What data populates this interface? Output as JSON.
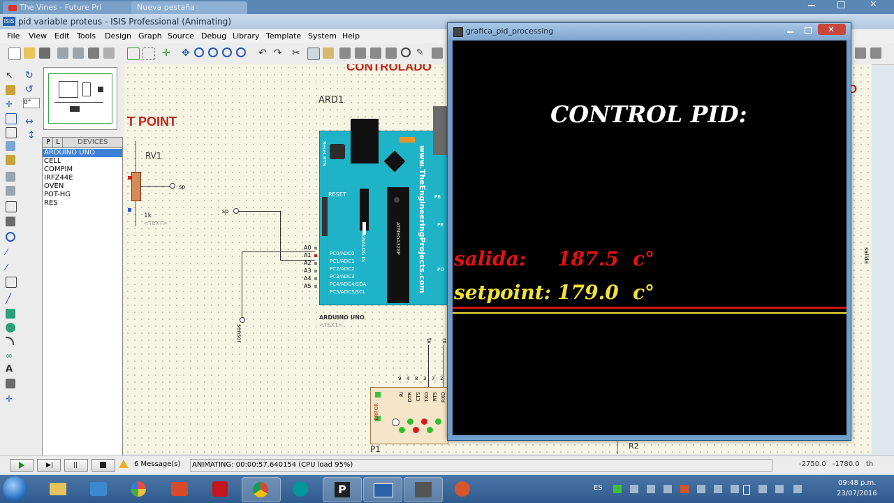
{
  "browser_tabs": [
    {
      "title": "The Vines - Future Pri"
    },
    {
      "title": "Nueva pestaña"
    }
  ],
  "window": {
    "title": "pid variable proteus - ISIS Professional (Animating)",
    "icon_label": "ISIS"
  },
  "menu": [
    "File",
    "View",
    "Edit",
    "Tools",
    "Design",
    "Graph",
    "Source",
    "Debug",
    "Library",
    "Template",
    "System",
    "Help"
  ],
  "rotation": {
    "value": "0°"
  },
  "device_panel": {
    "tab_p": "P",
    "tab_l": "L",
    "header": "DEVICES",
    "items": [
      "ARDUINO UNO",
      "CELL",
      "COMPIM",
      "IRFZ44E",
      "OVEN",
      "POT-HG",
      "RES"
    ],
    "selected_index": 0
  },
  "schematic": {
    "title_partial": "CONTROLADO",
    "setpoint_label": "T POINT",
    "pot_ref": "RV1",
    "pot_value": "1k",
    "text_placeholder": "<TEXT>",
    "sp_label": "sp",
    "sensor_label": "sensor",
    "salida_label": "salida",
    "arduino_ref": "ARD1",
    "arduino_name": "ARDUINO UNO",
    "website": "www.TheEngineeringProjects.com",
    "reset_btn": "Reset BTN",
    "reset_pin": "RESET",
    "analog_in": "ANALOG IN",
    "pins_analog": [
      "A0",
      "A1",
      "A2",
      "A3",
      "A4",
      "A5"
    ],
    "ports": [
      "PC0/ADC0",
      "PC1/ADC1",
      "PC2/ADC2",
      "PC3/ADC3",
      "PC4/ADC4/SDA",
      "PC5/ADC5/SCL"
    ],
    "chip_label": "ATMEGA328P",
    "right_labels": [
      "PB",
      "PB",
      "PD"
    ],
    "compim": {
      "ref": "P1",
      "error": "ERROR",
      "pins": [
        "RI",
        "DTR",
        "CTS",
        "TXD",
        "RTS",
        "RXD"
      ],
      "numbers": [
        "9",
        "4",
        "8",
        "3",
        "7",
        "2"
      ]
    },
    "r2": "R2",
    "tx_label": "tx",
    "rx_label": "rx",
    "right_partial": "O"
  },
  "status": {
    "messages": "6 Message(s)",
    "animating": "ANIMATING: 00:00:57.640154 (CPU load 95%)",
    "coord_x": "-2750.0",
    "coord_y": "-1780.0",
    "unit": "th"
  },
  "processing": {
    "title": "grafica_pid_processing",
    "heading": "CONTROL PID:",
    "salida_label": "salida:",
    "salida_value": "187.5",
    "setpoint_label": "setpoint:",
    "setpoint_value": "179.0",
    "unit": "c°",
    "colors": {
      "salida": "#e21212",
      "setpoint": "#f2e234"
    }
  },
  "taskbar": {
    "lang": "ES",
    "time": "09:48 p.m.",
    "date": "23/07/2016"
  }
}
